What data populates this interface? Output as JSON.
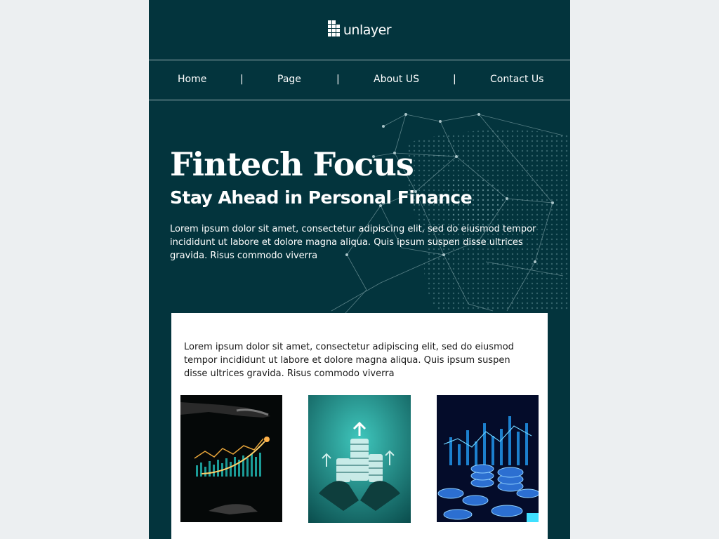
{
  "logo": {
    "text": "unlayer",
    "icon": "unlayer-logo-icon"
  },
  "nav": {
    "items": [
      {
        "label": "Home"
      },
      {
        "label": "Page"
      },
      {
        "label": "About US"
      },
      {
        "label": "Contact Us"
      }
    ],
    "separator": "|"
  },
  "hero": {
    "title": "Fintech Focus",
    "subtitle": "Stay Ahead in Personal Finance",
    "body": "Lorem ipsum dolor sit amet, consectetur adipiscing elit, sed do eiusmod tempor incididunt ut labore et dolore magna aliqua. Quis ipsum suspen disse ultrices gravida. Risus commodo viverra"
  },
  "card": {
    "body": "Lorem ipsum dolor sit amet, consectetur adipiscing elit, sed do eiusmod tempor incididunt ut labore et dolore magna aliqua. Quis ipsum suspen disse ultrices gravida. Risus commodo viverra",
    "images": [
      {
        "icon": "finance-growth-chart-image"
      },
      {
        "icon": "coin-stack-growth-image"
      },
      {
        "icon": "coins-bar-chart-image"
      }
    ]
  },
  "colors": {
    "page_bg": "#eceff1",
    "email_bg": "#03343d",
    "card_bg": "#ffffff",
    "accent": "#1fb5b1"
  }
}
